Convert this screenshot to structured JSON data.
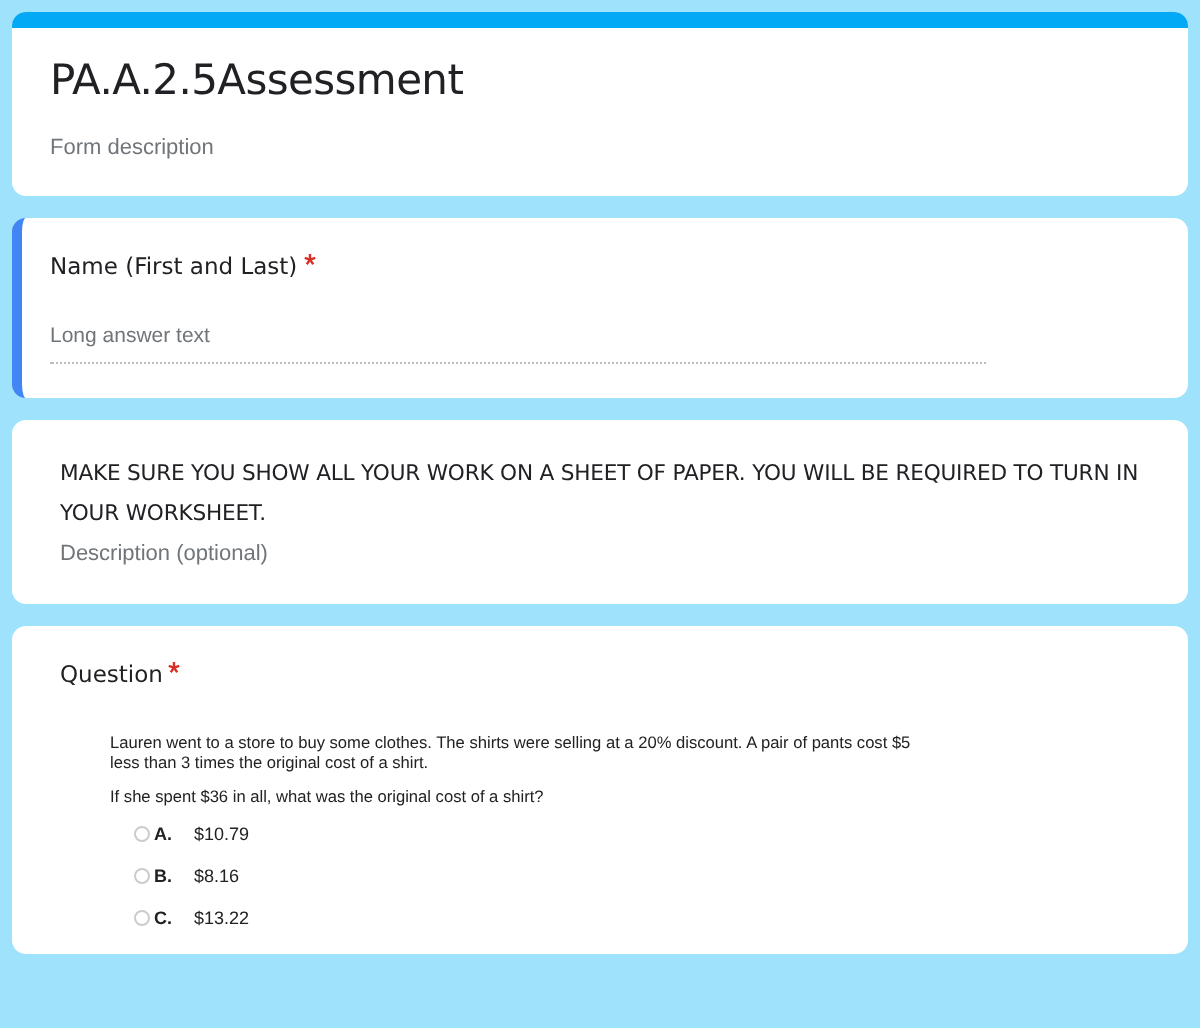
{
  "header": {
    "title": "PA.A.2.5Assessment",
    "placeholder": "Form description"
  },
  "items": [
    {
      "kind": "text",
      "title": "Name (First and Last)",
      "required": true,
      "selected": true,
      "placeholder": "Long answer text"
    },
    {
      "kind": "section",
      "title": "MAKE SURE YOU SHOW ALL YOUR WORK ON A SHEET OF PAPER. YOU WILL BE REQUIRED TO TURN IN YOUR WORKSHEET.",
      "required": false,
      "selected": false,
      "placeholder": "Description (optional)"
    },
    {
      "kind": "choice",
      "title": "Question",
      "required": true,
      "selected": false,
      "problem": [
        "Lauren went to a store to buy some clothes. The shirts were selling at a 20% discount. A pair of pants cost $5 less than 3 times the original cost of a shirt.",
        "If she spent $36 in all, what was the original cost of a shirt?"
      ],
      "options": [
        {
          "letter": "A.",
          "text": "$10.79",
          "selected": false
        },
        {
          "letter": "B.",
          "text": "$8.16",
          "selected": false
        },
        {
          "letter": "C.",
          "text": "$13.22",
          "selected": false
        }
      ]
    }
  ]
}
